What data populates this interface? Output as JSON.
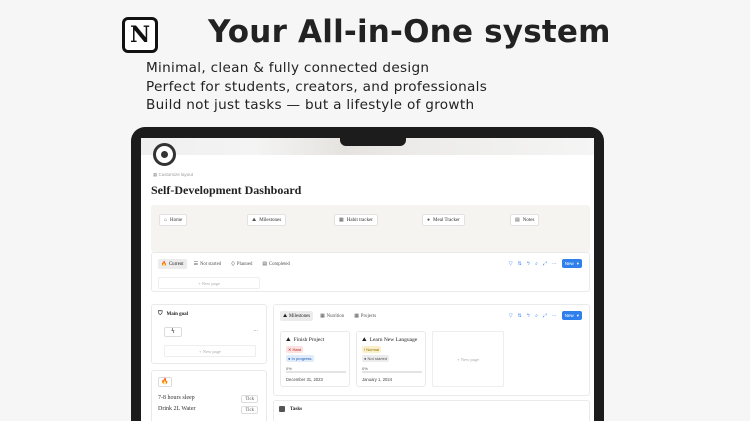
{
  "hero": {
    "headline": "Your All-in-One system",
    "logo_letter": "N",
    "taglines": [
      "Minimal, clean & fully connected design",
      "Perfect for students, creators, and professionals",
      "Build not just tasks — but a lifestyle of growth"
    ]
  },
  "page": {
    "customize_label": "Customize layout",
    "title": "Self-Development Dashboard"
  },
  "nav": [
    {
      "label": "Home",
      "icon": "home-icon",
      "glyph": "⌂"
    },
    {
      "label": "Milestones",
      "icon": "milestone-icon",
      "glyph": "⛰"
    },
    {
      "label": "Habit tracker",
      "icon": "habit-icon",
      "glyph": "▦"
    },
    {
      "label": "Meal Tracker",
      "icon": "meal-icon",
      "glyph": "●"
    },
    {
      "label": "Notes",
      "icon": "notes-icon",
      "glyph": "▤"
    }
  ],
  "views": {
    "tabs": [
      "Current",
      "Not started",
      "Planned",
      "Completed"
    ],
    "new_label": "New",
    "new_page": "+ New page"
  },
  "main_goal": {
    "title": "Main goal",
    "new_page": "+ New page",
    "more": "···"
  },
  "habits": {
    "rows": [
      {
        "label": "7-8 hours sleep",
        "action": "Tick"
      },
      {
        "label": "Drink 2L Water",
        "action": "Tick"
      }
    ]
  },
  "milestones": {
    "tabs": [
      "Milestones",
      "Nutrition",
      "Projects"
    ],
    "new_label": "New",
    "new_page": "+ New page",
    "cards": [
      {
        "title": "Finish Project",
        "priority": "Hard",
        "status": "In progress",
        "progress": "0%",
        "progress_value": 0,
        "date": "December 31, 2023"
      },
      {
        "title": "Learn New Language",
        "priority": "Normal",
        "status": "Not started",
        "progress": "0%",
        "progress_value": 0,
        "date": "January 1, 2024"
      }
    ]
  },
  "tasks": {
    "title": "Tasks"
  },
  "colors": {
    "accent": "#2f80ed",
    "bezel": "#1c1c1c",
    "nav_background": "#f5f4f1"
  }
}
